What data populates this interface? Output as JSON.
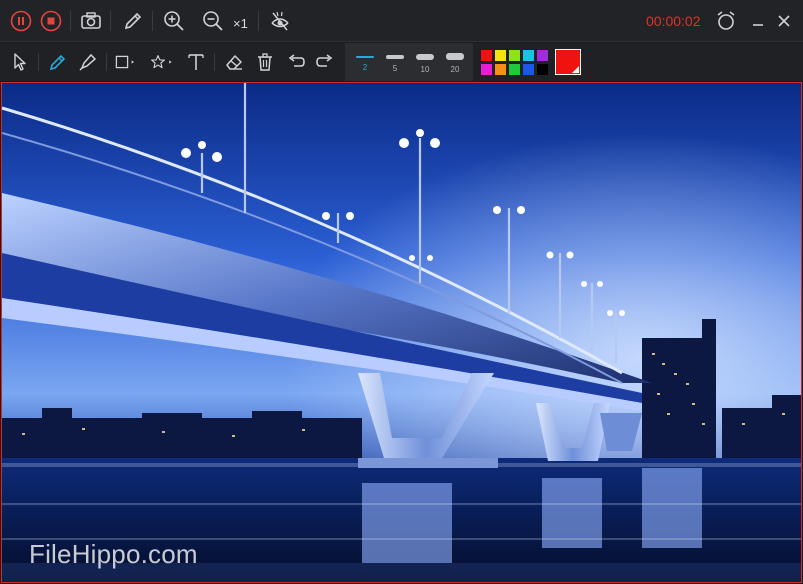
{
  "topbar": {
    "zoom_label": "×1",
    "timer": "00:00:02",
    "buttons": [
      {
        "name": "pause-record-icon"
      },
      {
        "name": "stop-record-icon"
      },
      {
        "name": "camera-icon"
      },
      {
        "name": "pencil-icon"
      },
      {
        "name": "zoom-in-icon"
      },
      {
        "name": "zoom-out-icon"
      },
      {
        "name": "hide-icon"
      },
      {
        "name": "alarm-clock-icon"
      },
      {
        "name": "minimize-icon"
      },
      {
        "name": "close-icon"
      }
    ],
    "timer_color": "#e0312b"
  },
  "toolbar2": {
    "tools": [
      "select-arrow-icon",
      "pen-icon",
      "highlighter-icon",
      "rectangle-icon",
      "star-icon",
      "text-icon",
      "eraser-icon",
      "trash-icon",
      "undo-icon",
      "redo-icon"
    ],
    "sizes": [
      {
        "label": "2",
        "active": true
      },
      {
        "label": "5",
        "active": false
      },
      {
        "label": "10",
        "active": false
      },
      {
        "label": "20",
        "active": false
      }
    ],
    "palette": [
      "#f0120e",
      "#f5e30f",
      "#8fe21a",
      "#19c3e3",
      "#a12be3",
      "#e61fd6",
      "#f59016",
      "#1ec93d",
      "#1c57e8",
      "#000000"
    ],
    "current_color": "#f0120e",
    "accent": "#2aa8d8"
  },
  "canvas": {
    "watermark": "FileHippo.com",
    "border_color": "#d42a22"
  }
}
